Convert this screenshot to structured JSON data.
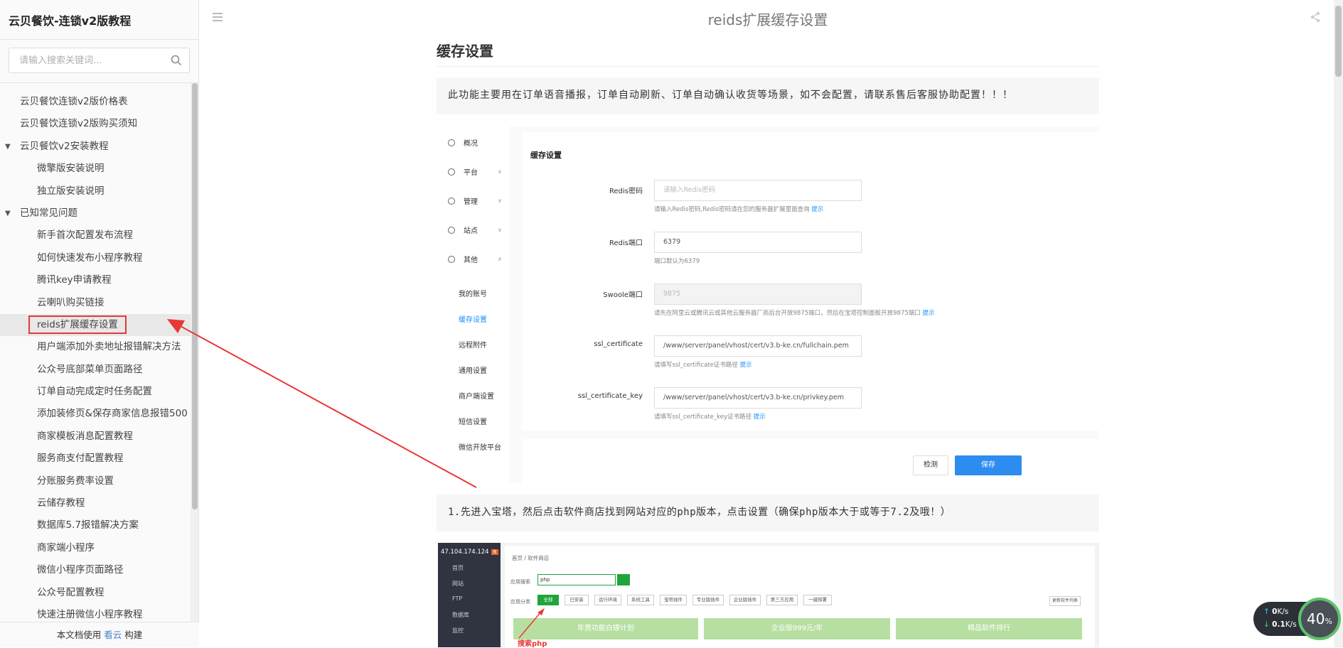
{
  "sidebar": {
    "book_title": "云贝餐饮-连锁v2版教程",
    "search_placeholder": "请输入搜索关键词...",
    "items": [
      {
        "label": "云贝餐饮连锁v2版价格表",
        "level": 1
      },
      {
        "label": "云贝餐饮连锁v2版购买须知",
        "level": 1
      },
      {
        "label": "云贝餐饮v2安装教程",
        "level": 1,
        "expanded": true
      },
      {
        "label": "微擎版安装说明",
        "level": 2
      },
      {
        "label": "独立版安装说明",
        "level": 2
      },
      {
        "label": "已知常见问题",
        "level": 1,
        "expanded": true
      },
      {
        "label": "新手首次配置发布流程",
        "level": 2
      },
      {
        "label": "如何快速发布小程序教程",
        "level": 2
      },
      {
        "label": "腾讯key申请教程",
        "level": 2
      },
      {
        "label": "云喇叭购买链接",
        "level": 2
      },
      {
        "label": "reids扩展缓存设置",
        "level": 2,
        "active": true
      },
      {
        "label": "用户端添加外卖地址报错解决方法",
        "level": 2
      },
      {
        "label": "公众号底部菜单页面路径",
        "level": 2
      },
      {
        "label": "订单自动完成定时任务配置",
        "level": 2
      },
      {
        "label": "添加装修页&保存商家信息报错500",
        "level": 2
      },
      {
        "label": "商家模板消息配置教程",
        "level": 2
      },
      {
        "label": "服务商支付配置教程",
        "level": 2
      },
      {
        "label": "分账服务费率设置",
        "level": 2
      },
      {
        "label": "云储存教程",
        "level": 2
      },
      {
        "label": "数据库5.7报错解决方案",
        "level": 2
      },
      {
        "label": "商家端小程序",
        "level": 2
      },
      {
        "label": "微信小程序页面路径",
        "level": 2
      },
      {
        "label": "公众号配置教程",
        "level": 2
      },
      {
        "label": "快速注册微信小程序教程",
        "level": 2
      }
    ],
    "footer_prefix": "本文档使用",
    "footer_link": "看云",
    "footer_suffix": "构建"
  },
  "header": {
    "title": "reids扩展缓存设置"
  },
  "content": {
    "heading": "缓存设置",
    "note": "此功能主要用在订单语音播报，订单自动刷新、订单自动确认收货等场景，如不会配置，请联系售后客服协助配置！！！",
    "step1": "1.先进入宝塔，然后点击软件商店找到网站对应的php版本，点击设置（确保php版本大于或等于7.2及哦！）"
  },
  "admin_shot": {
    "menu": [
      {
        "label": "概况",
        "chevron": ""
      },
      {
        "label": "平台",
        "chevron": "∨"
      },
      {
        "label": "管理",
        "chevron": "∨"
      },
      {
        "label": "站点",
        "chevron": "∨"
      },
      {
        "label": "其他",
        "chevron": "∧"
      }
    ],
    "submenu": [
      "我的账号",
      "缓存设置",
      "远程附件",
      "通用设置",
      "商户端设置",
      "短信设置",
      "微信开放平台"
    ],
    "panel_title": "缓存设置",
    "fields": [
      {
        "label": "Redis密码",
        "value": "请输入Redis密码",
        "help": "请输入Redis密码,Redis密码请在您的服务器扩展里面查询",
        "tip": "提示",
        "style": "ph"
      },
      {
        "label": "Redis端口",
        "value": "6379",
        "help": "端口默认为6379",
        "tip": "",
        "style": ""
      },
      {
        "label": "Swoole端口",
        "value": "9875",
        "help": "请先在阿里云或腾讯云或其他云服务器厂商后台开放9875端口，然后在宝塔控制面板开放9875端口",
        "tip": "提示",
        "style": "dis"
      },
      {
        "label": "ssl_certificate",
        "value": "/www/server/panel/vhost/cert/v3.b-ke.cn/fullchain.pem",
        "help": "请填写ssl_certificate证书路径",
        "tip": "提示",
        "style": ""
      },
      {
        "label": "ssl_certificate_key",
        "value": "/www/server/panel/vhost/cert/v3.b-ke.cn/privkey.pem",
        "help": "请填写ssl_certificate_key证书路径",
        "tip": "提示",
        "style": ""
      }
    ],
    "btn_check": "检测",
    "btn_save": "保存"
  },
  "baota_shot": {
    "ip": "47.104.174.124",
    "badge": "8",
    "nav": [
      "首页",
      "网站",
      "FTP",
      "数据库",
      "监控"
    ],
    "crumb": "首页 / 软件商店",
    "search_label": "应用搜索",
    "search_value": "php",
    "cats_label": "应用分类",
    "cats": [
      "全部",
      "已安装",
      "运行环境",
      "系统工具",
      "宝塔插件",
      "专业版插件",
      "企业版插件",
      "第三方应用",
      "一键部署"
    ],
    "more": "更新软件列表",
    "promos": [
      "年费功能白嫖计划",
      "企业版999元/年",
      "精品软件排行"
    ],
    "red_note": "搜索php"
  },
  "network": {
    "up": "0",
    "up_unit": "K/s",
    "down": "0.1",
    "down_unit": "K/s",
    "percent": "40",
    "percent_unit": "%"
  },
  "colors": {
    "accent": "#2d8cf0",
    "highlight": "#e53935",
    "baota_green": "#20a53a"
  }
}
